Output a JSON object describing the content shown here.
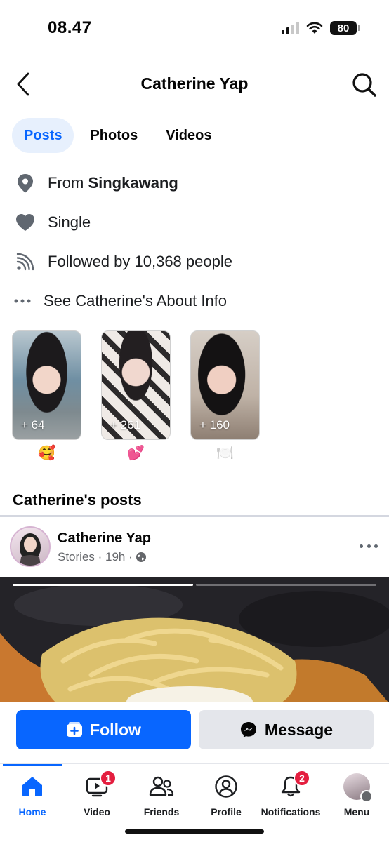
{
  "status_bar": {
    "time": "08.47",
    "battery": "80"
  },
  "header": {
    "title": "Catherine Yap"
  },
  "tabs": [
    {
      "label": "Posts",
      "active": true
    },
    {
      "label": "Photos",
      "active": false
    },
    {
      "label": "Videos",
      "active": false
    }
  ],
  "about": {
    "from_prefix": "From ",
    "from_place": "Singkawang",
    "relationship": "Single",
    "followers": "Followed by 10,368 people",
    "see_about": "See Catherine's About Info"
  },
  "highlights": [
    {
      "count": "+ 64",
      "emoji": "🥰"
    },
    {
      "count": "+ 261",
      "emoji": "💕"
    },
    {
      "count": "+ 160",
      "emoji": "🍽️"
    }
  ],
  "posts_section": {
    "title": "Catherine's posts"
  },
  "post": {
    "author": "Catherine Yap",
    "meta": "Stories · 19h ·"
  },
  "actions": {
    "follow": "Follow",
    "message": "Message"
  },
  "bottom_nav": {
    "home": "Home",
    "video": "Video",
    "video_badge": "1",
    "friends": "Friends",
    "profile": "Profile",
    "notifications": "Notifications",
    "notifications_badge": "2",
    "menu": "Menu"
  },
  "colors": {
    "accent": "#0866ff",
    "badge": "#e41e3f",
    "tab_active_bg": "#e7f0fd"
  }
}
